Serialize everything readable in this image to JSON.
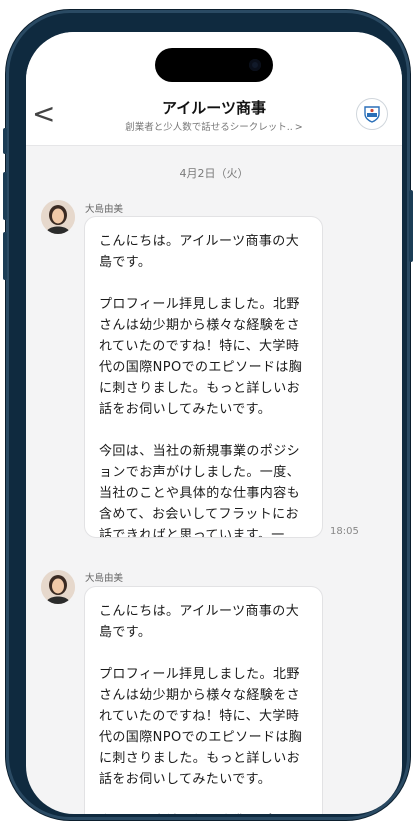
{
  "header": {
    "title": "アイルーツ商事",
    "subtitle": "創業者と少人数で話せるシークレット..",
    "subtitle_chevron": ">",
    "back_glyph": "<"
  },
  "chat": {
    "date": "4月2日（火）",
    "messages": [
      {
        "sender": "大島由美",
        "text": "こんにちは。アイルーツ商事の大島です。\n\nプロフィール拝見しました。北野さんは幼少期から様々な経験をされていたのですね！特に、大学時代の国際NPOでのエピソードは胸に刺さりました。もっと詳しいお話をお伺いしてみたいです。\n\n今回は、当社の新規事業のポジションでお声がけしました。一度、当社のことや具体的な仕事内容も含めて、お会いしてフラットにお話できればと思っています。一度、お茶を飲みに当社のオフィスに遊びに来ませんか？",
        "time": "18:05"
      },
      {
        "sender": "大島由美",
        "text": "こんにちは。アイルーツ商事の大島です。\n\nプロフィール拝見しました。北野さんは幼少期から様々な経験をされていたのですね！特に、大学時代の国際NPOでのエピソードは胸に刺さりました。もっと詳しいお話をお伺いしてみたいです。\n\n今回は、当社の新規事業のポジションでお声がけしました。一度、",
        "time": ""
      }
    ]
  },
  "colors": {
    "frame": "#0f2a3f",
    "screen_bg": "#f4f4f5",
    "bubble_bg": "#ffffff",
    "logo_accent": "#2a6fb8"
  }
}
